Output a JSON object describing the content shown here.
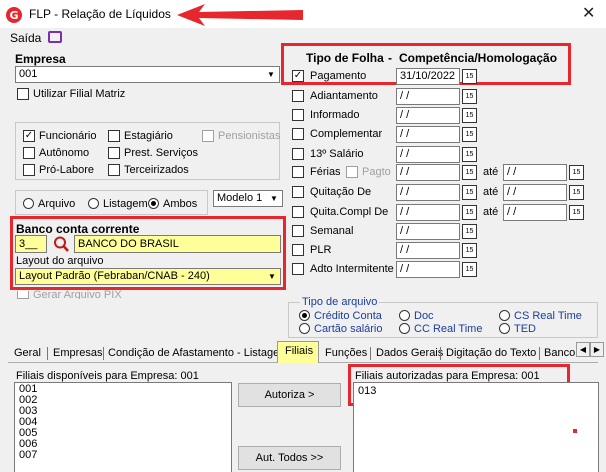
{
  "window": {
    "title": "FLP - Relação de Líquidos",
    "close_glyph": "✕"
  },
  "menu": {
    "saida": "Saída"
  },
  "empresa": {
    "label": "Empresa",
    "value": "001",
    "utilizar_filial_matriz": "Utilizar Filial Matriz"
  },
  "categorias": {
    "funcionario": {
      "label": "Funcionário",
      "checked": true
    },
    "estagiario": {
      "label": "Estagiário",
      "checked": false
    },
    "pensionistas": {
      "label": "Pensionistas",
      "checked": false
    },
    "autonomo": {
      "label": "Autônomo",
      "checked": false
    },
    "prest_servicos": {
      "label": "Prest. Serviços",
      "checked": false
    },
    "pro_labore": {
      "label": "Pró-Labore",
      "checked": false
    },
    "terceirizados": {
      "label": "Terceirizados",
      "checked": false
    }
  },
  "saida_tipo": {
    "arquivo": "Arquivo",
    "listagem": "Listagem",
    "ambos": "Ambos",
    "modelo": "Modelo 1"
  },
  "banco": {
    "label": "Banco conta corrente",
    "codigo": "3__",
    "nome": "BANCO DO BRASIL",
    "layout_label": "Layout do arquivo",
    "layout_value": "Layout Padrão (Febraban/CNAB - 240)",
    "gerar_pix": "Gerar Arquivo PIX"
  },
  "folha": {
    "header_tipo": "Tipo de Folha",
    "header_sep": "-",
    "header_comp": "Competência/Homologação",
    "ate": "até",
    "pagto": "Pagto",
    "empty_date": " /  /",
    "rows": [
      {
        "label": "Pagamento",
        "checked": true,
        "date": "31/10/2022"
      },
      {
        "label": "Adiantamento",
        "checked": false,
        "date": " /  /"
      },
      {
        "label": "Informado",
        "checked": false,
        "date": " /  /"
      },
      {
        "label": "Complementar",
        "checked": false,
        "date": " /  /"
      },
      {
        "label": "13º Salário",
        "checked": false,
        "date": " /  /"
      },
      {
        "label": "Férias",
        "checked": false,
        "date": " /  /"
      },
      {
        "label": "Quitação De",
        "checked": false,
        "date": " /  /"
      },
      {
        "label": "Quita.Compl De",
        "checked": false,
        "date": " /  /"
      },
      {
        "label": "Semanal",
        "checked": false,
        "date": " /  /"
      },
      {
        "label": "PLR",
        "checked": false,
        "date": " /  /"
      },
      {
        "label": "Adto Intermitente",
        "checked": false,
        "date": " /  /"
      }
    ]
  },
  "tipo_arquivo": {
    "label": "Tipo de arquivo",
    "credito_conta": "Crédito Conta",
    "doc": "Doc",
    "cs_real_time": "CS Real Time",
    "cartao_salario": "Cartão salário",
    "cc_real_time": "CC Real Time",
    "ted": "TED"
  },
  "tabs": [
    "Geral",
    "Empresas",
    "Condição de Afastamento - Listagem",
    "Filiais",
    "Funções",
    "Dados Gerais",
    "Digitação do Texto",
    "Banco"
  ],
  "filiais": {
    "disponiveis_label": "Filiais disponíveis para Empresa: 001",
    "disponiveis": [
      "001",
      "002",
      "003",
      "004",
      "005",
      "006",
      "007"
    ],
    "autorizadas_label": "Filiais autorizadas para Empresa: 001",
    "autorizadas": [
      "013"
    ],
    "autoriza_btn": "Autoriza >",
    "aut_todos_btn": "Aut. Todos >>"
  },
  "colors": {
    "highlight_red": "#e8262d",
    "highlight_yellow": "#ffff99",
    "accent_purple": "#7a2fb3"
  }
}
